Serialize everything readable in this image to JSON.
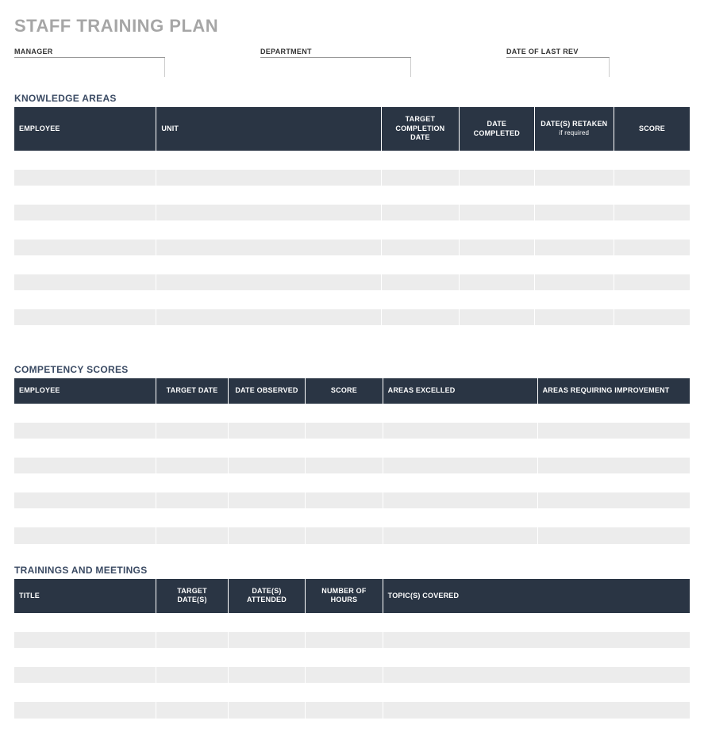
{
  "title": "STAFF TRAINING PLAN",
  "meta": {
    "manager_label": "MANAGER",
    "manager_value": "",
    "department_label": "DEPARTMENT",
    "department_value": "",
    "date_rev_label": "DATE OF LAST REV",
    "date_rev_value": ""
  },
  "sections": {
    "knowledge": {
      "title": "KNOWLEDGE AREAS",
      "headers": {
        "employee": "EMPLOYEE",
        "unit": "UNIT",
        "target_completion": "TARGET COMPLETION DATE",
        "date_completed": "DATE COMPLETED",
        "dates_retaken": "DATE(S) RETAKEN",
        "dates_retaken_sub": "if required",
        "score": "SCORE"
      },
      "rows": [
        {
          "employee": "",
          "unit": "",
          "target_completion": "",
          "date_completed": "",
          "dates_retaken": "",
          "score": ""
        },
        {
          "employee": "",
          "unit": "",
          "target_completion": "",
          "date_completed": "",
          "dates_retaken": "",
          "score": ""
        },
        {
          "employee": "",
          "unit": "",
          "target_completion": "",
          "date_completed": "",
          "dates_retaken": "",
          "score": ""
        },
        {
          "employee": "",
          "unit": "",
          "target_completion": "",
          "date_completed": "",
          "dates_retaken": "",
          "score": ""
        },
        {
          "employee": "",
          "unit": "",
          "target_completion": "",
          "date_completed": "",
          "dates_retaken": "",
          "score": ""
        },
        {
          "employee": "",
          "unit": "",
          "target_completion": "",
          "date_completed": "",
          "dates_retaken": "",
          "score": ""
        },
        {
          "employee": "",
          "unit": "",
          "target_completion": "",
          "date_completed": "",
          "dates_retaken": "",
          "score": ""
        },
        {
          "employee": "",
          "unit": "",
          "target_completion": "",
          "date_completed": "",
          "dates_retaken": "",
          "score": ""
        },
        {
          "employee": "",
          "unit": "",
          "target_completion": "",
          "date_completed": "",
          "dates_retaken": "",
          "score": ""
        },
        {
          "employee": "",
          "unit": "",
          "target_completion": "",
          "date_completed": "",
          "dates_retaken": "",
          "score": ""
        },
        {
          "employee": "",
          "unit": "",
          "target_completion": "",
          "date_completed": "",
          "dates_retaken": "",
          "score": ""
        }
      ]
    },
    "competency": {
      "title": "COMPETENCY SCORES",
      "headers": {
        "employee": "EMPLOYEE",
        "target_date": "TARGET DATE",
        "date_observed": "DATE OBSERVED",
        "score": "SCORE",
        "areas_excelled": "AREAS EXCELLED",
        "areas_improve": "AREAS REQUIRING IMPROVEMENT"
      },
      "rows": [
        {
          "employee": "",
          "target_date": "",
          "date_observed": "",
          "score": "",
          "areas_excelled": "",
          "areas_improve": ""
        },
        {
          "employee": "",
          "target_date": "",
          "date_observed": "",
          "score": "",
          "areas_excelled": "",
          "areas_improve": ""
        },
        {
          "employee": "",
          "target_date": "",
          "date_observed": "",
          "score": "",
          "areas_excelled": "",
          "areas_improve": ""
        },
        {
          "employee": "",
          "target_date": "",
          "date_observed": "",
          "score": "",
          "areas_excelled": "",
          "areas_improve": ""
        },
        {
          "employee": "",
          "target_date": "",
          "date_observed": "",
          "score": "",
          "areas_excelled": "",
          "areas_improve": ""
        },
        {
          "employee": "",
          "target_date": "",
          "date_observed": "",
          "score": "",
          "areas_excelled": "",
          "areas_improve": ""
        },
        {
          "employee": "",
          "target_date": "",
          "date_observed": "",
          "score": "",
          "areas_excelled": "",
          "areas_improve": ""
        },
        {
          "employee": "",
          "target_date": "",
          "date_observed": "",
          "score": "",
          "areas_excelled": "",
          "areas_improve": ""
        }
      ]
    },
    "trainings": {
      "title": "TRAININGS AND MEETINGS",
      "headers": {
        "title_h": "TITLE",
        "target_dates": "TARGET DATE(S)",
        "dates_attended": "DATE(S) ATTENDED",
        "hours": "NUMBER OF HOURS",
        "topics": "TOPIC(S) COVERED"
      },
      "rows": [
        {
          "title": "",
          "target_dates": "",
          "dates_attended": "",
          "hours": "",
          "topics": ""
        },
        {
          "title": "",
          "target_dates": "",
          "dates_attended": "",
          "hours": "",
          "topics": ""
        },
        {
          "title": "",
          "target_dates": "",
          "dates_attended": "",
          "hours": "",
          "topics": ""
        },
        {
          "title": "",
          "target_dates": "",
          "dates_attended": "",
          "hours": "",
          "topics": ""
        },
        {
          "title": "",
          "target_dates": "",
          "dates_attended": "",
          "hours": "",
          "topics": ""
        },
        {
          "title": "",
          "target_dates": "",
          "dates_attended": "",
          "hours": "",
          "topics": ""
        }
      ]
    }
  }
}
